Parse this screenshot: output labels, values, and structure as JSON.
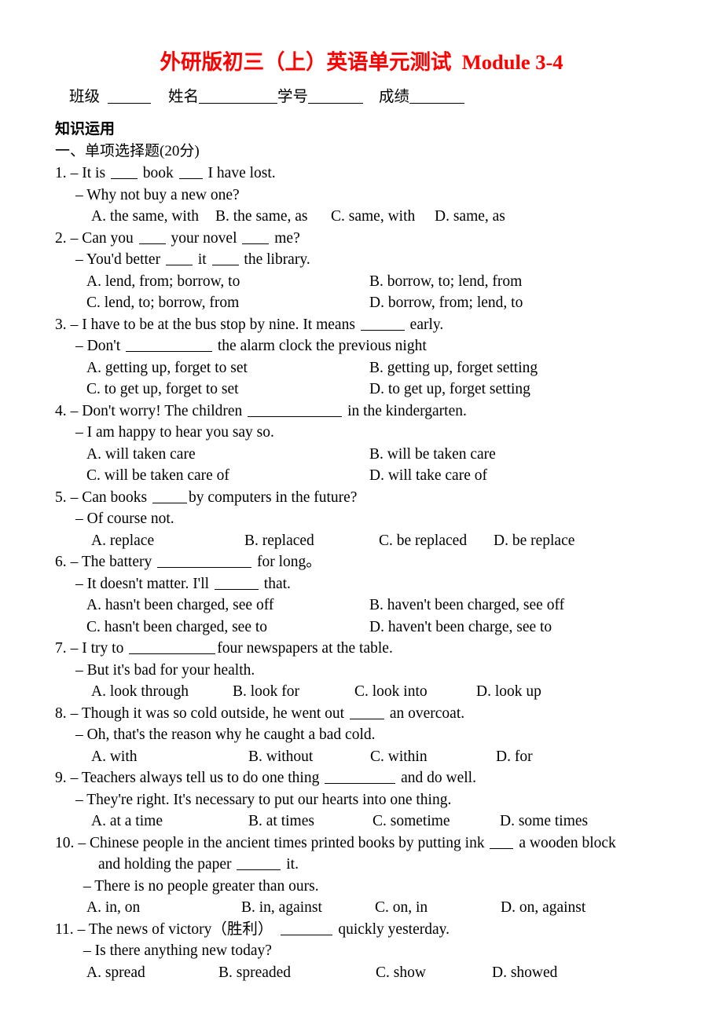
{
  "document": {
    "title": "外研版初三（上）英语单元测试  Module 3-4",
    "title_color": "#ff0000",
    "info": {
      "class_label": "班级",
      "name_label": "姓名",
      "student_id_label": "学号",
      "score_label": "成绩"
    },
    "section_heading": "知识运用",
    "section_subheading": "一、单项选择题(20分)"
  },
  "questions": [
    {
      "number": "1.",
      "stem_pre": "– It is ",
      "stem_mid": " book ",
      "stem_post": " I have lost.",
      "reply": "– Why not buy a new one?",
      "layout": "flow",
      "options": [
        {
          "key": "A.",
          "text": "A. the same, with"
        },
        {
          "key": "B.",
          "text": "B. the same, as"
        },
        {
          "key": "C.",
          "text": "C. same, with"
        },
        {
          "key": "D.",
          "text": "D. same, as"
        }
      ]
    },
    {
      "number": "2.",
      "stem_pre": "– Can you ",
      "stem_mid": " your novel ",
      "stem_post": " me?",
      "reply_pre": "– You'd better ",
      "reply_mid": " it ",
      "reply_post": " the library.",
      "layout": "two-column",
      "options": [
        {
          "key": "A.",
          "text": "A. lend, from; borrow, to"
        },
        {
          "key": "B.",
          "text": "B. borrow, to; lend, from"
        },
        {
          "key": "C.",
          "text": "C. lend, to; borrow, from"
        },
        {
          "key": "D.",
          "text": "D. borrow, from; lend, to"
        }
      ]
    },
    {
      "number": "3.",
      "stem_pre": "– I have to be at the bus stop by nine. It means ",
      "stem_post": " early.",
      "reply_pre": "– Don't ",
      "reply_post": " the alarm clock the previous night",
      "layout": "two-column",
      "options": [
        {
          "key": "A.",
          "text": "A. getting up, forget to set"
        },
        {
          "key": "B.",
          "text": "B. getting up, forget setting"
        },
        {
          "key": "C.",
          "text": "C. to get up, forget to set"
        },
        {
          "key": "D.",
          "text": "D. to get up, forget setting"
        }
      ]
    },
    {
      "number": "4.",
      "stem_pre": "– Don't worry! The children ",
      "stem_post": " in the kindergarten.",
      "reply": "– I am happy to hear you say so.",
      "layout": "two-column",
      "options": [
        {
          "key": "A.",
          "text": "A. will taken care"
        },
        {
          "key": "B.",
          "text": "B. will be taken care"
        },
        {
          "key": "C.",
          "text": "C. will be taken care of"
        },
        {
          "key": "D.",
          "text": "D. will take care of"
        }
      ]
    },
    {
      "number": "5.",
      "stem_pre": "– Can books ",
      "stem_post": "by computers in the future?",
      "reply": "– Of course not.",
      "layout": "flow",
      "options": [
        {
          "key": "A.",
          "text": "A. replace"
        },
        {
          "key": "B.",
          "text": "B. replaced"
        },
        {
          "key": "C.",
          "text": "C. be replaced"
        },
        {
          "key": "D.",
          "text": "D. be replace"
        }
      ]
    },
    {
      "number": "6.",
      "stem_pre": "– The battery ",
      "stem_post": " for long。",
      "reply_pre": "– It doesn't matter. I'll ",
      "reply_post": " that.",
      "layout": "two-column",
      "options": [
        {
          "key": "A.",
          "text": "A. hasn't been charged, see off"
        },
        {
          "key": "B.",
          "text": "B. haven't been charged, see off"
        },
        {
          "key": "C.",
          "text": "C. hasn't been charged, see to"
        },
        {
          "key": "D.",
          "text": "D. haven't been charge, see to"
        }
      ]
    },
    {
      "number": "7.",
      "stem_pre": "– I try to ",
      "stem_post": "four newspapers at the table.",
      "reply": "– But it's bad for your health.",
      "layout": "flow",
      "options": [
        {
          "key": "A.",
          "text": "A. look through"
        },
        {
          "key": "B.",
          "text": "B. look for"
        },
        {
          "key": "C.",
          "text": "C. look into"
        },
        {
          "key": "D.",
          "text": "D. look up"
        }
      ]
    },
    {
      "number": "8.",
      "stem_pre": "– Though it was so cold outside, he went out ",
      "stem_post": " an overcoat.",
      "reply": "– Oh, that's the reason why he caught a bad cold.",
      "layout": "flow",
      "options": [
        {
          "key": "A.",
          "text": "A. with"
        },
        {
          "key": "B.",
          "text": "B. without"
        },
        {
          "key": "C.",
          "text": "C. within"
        },
        {
          "key": "D.",
          "text": "D. for"
        }
      ]
    },
    {
      "number": "9.",
      "stem_pre": "– Teachers always tell us to do one thing ",
      "stem_post": " and do well.",
      "reply": "– They're right. It's necessary to put our hearts into one thing.",
      "layout": "flow",
      "options": [
        {
          "key": "A.",
          "text": "A. at a time"
        },
        {
          "key": "B.",
          "text": "B. at times"
        },
        {
          "key": "C.",
          "text": "C. sometime"
        },
        {
          "key": "D.",
          "text": "D. some times"
        }
      ]
    },
    {
      "number": "10.",
      "stem_pre": "– Chinese people in the ancient times printed books by putting ink ",
      "stem_post": " a wooden block",
      "stem_line2_pre": "and holding the paper ",
      "stem_line2_post": " it.",
      "reply": "– There is no people greater than ours.",
      "layout": "flow",
      "options": [
        {
          "key": "A.",
          "text": "A. in, on"
        },
        {
          "key": "B.",
          "text": "B. in, against"
        },
        {
          "key": "C.",
          "text": "C. on, in"
        },
        {
          "key": "D.",
          "text": "D. on, against"
        }
      ]
    },
    {
      "number": "11.",
      "stem_pre": "– The news of victory（胜利）",
      "stem_post": " quickly yesterday.",
      "reply": "– Is there anything new today?",
      "layout": "flow",
      "options": [
        {
          "key": "A.",
          "text": "A. spread"
        },
        {
          "key": "B.",
          "text": "B. spreaded"
        },
        {
          "key": "C.",
          "text": "C. show"
        },
        {
          "key": "D.",
          "text": "D. showed"
        }
      ]
    }
  ]
}
